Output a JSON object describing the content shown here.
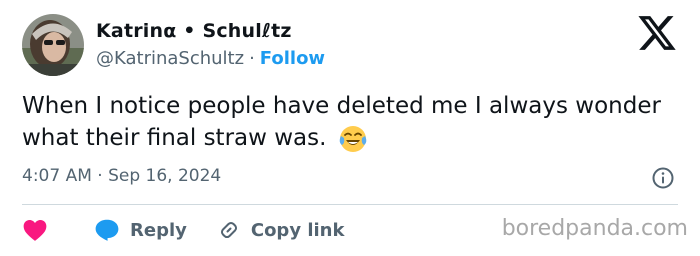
{
  "author": {
    "display_name": "Katrinα • Schulℓtz",
    "handle": "@KatrinaSchultz",
    "separator": "·",
    "follow_label": "Follow"
  },
  "tweet": {
    "text": "When I notice people have deleted me I always wonder what their final straw was.",
    "emoji": "😂",
    "timestamp": "4:07 AM · Sep 16, 2024"
  },
  "actions": {
    "reply_label": "Reply",
    "copy_link_label": "Copy link"
  },
  "watermark": "boredpanda.com",
  "colors": {
    "accent": "#1d9bf0",
    "like": "#f91880",
    "muted": "#536471",
    "text": "#0f1419",
    "divider": "#cfd9de"
  }
}
